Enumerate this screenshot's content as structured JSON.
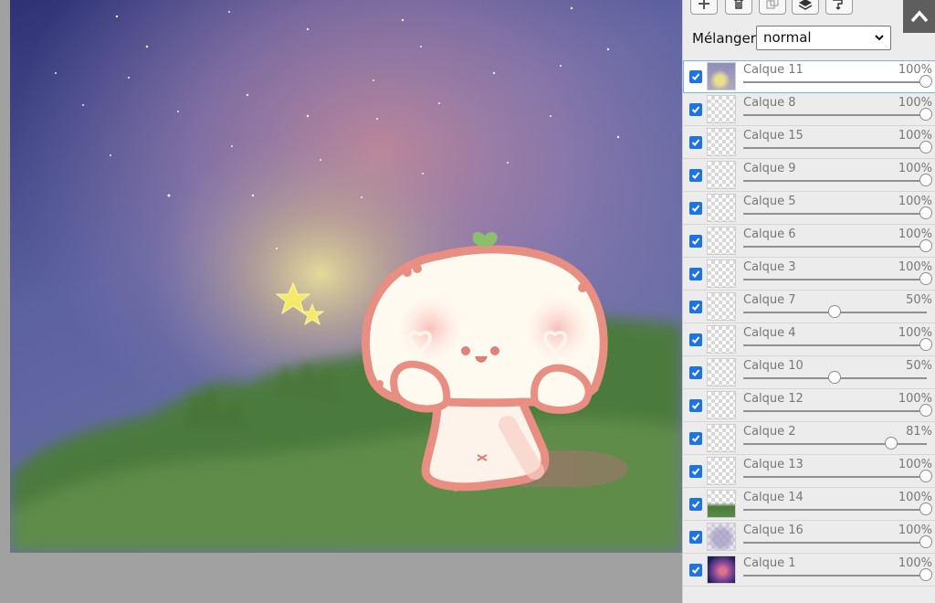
{
  "toolbar": {
    "icons": [
      "plus-icon",
      "trash-icon",
      "duplicate-icon",
      "layers-icon",
      "merge-down-icon"
    ],
    "collapse_icon": "chevron-up-icon"
  },
  "blend": {
    "label": "Mélanger",
    "value": "normal"
  },
  "layers": [
    {
      "name": "Calque 11",
      "opacity": "100%",
      "level": 100,
      "visible": true,
      "selected": true,
      "thumb": "glow"
    },
    {
      "name": "Calque 8",
      "opacity": "100%",
      "level": 100,
      "visible": true,
      "thumb": "empty"
    },
    {
      "name": "Calque 15",
      "opacity": "100%",
      "level": 100,
      "visible": true,
      "thumb": "empty"
    },
    {
      "name": "Calque 9",
      "opacity": "100%",
      "level": 100,
      "visible": true,
      "thumb": "empty"
    },
    {
      "name": "Calque 5",
      "opacity": "100%",
      "level": 100,
      "visible": true,
      "thumb": "empty"
    },
    {
      "name": "Calque 6",
      "opacity": "100%",
      "level": 100,
      "visible": true,
      "thumb": "empty"
    },
    {
      "name": "Calque 3",
      "opacity": "100%",
      "level": 100,
      "visible": true,
      "thumb": "empty"
    },
    {
      "name": "Calque 7",
      "opacity": "50%",
      "level": 50,
      "visible": true,
      "thumb": "empty"
    },
    {
      "name": "Calque 4",
      "opacity": "100%",
      "level": 100,
      "visible": true,
      "thumb": "empty"
    },
    {
      "name": "Calque 10",
      "opacity": "50%",
      "level": 50,
      "visible": true,
      "thumb": "empty"
    },
    {
      "name": "Calque 12",
      "opacity": "100%",
      "level": 100,
      "visible": true,
      "thumb": "empty"
    },
    {
      "name": "Calque 2",
      "opacity": "81%",
      "level": 81,
      "visible": true,
      "thumb": "empty"
    },
    {
      "name": "Calque 13",
      "opacity": "100%",
      "level": 100,
      "visible": true,
      "thumb": "empty"
    },
    {
      "name": "Calque 14",
      "opacity": "100%",
      "level": 100,
      "visible": true,
      "thumb": "grass"
    },
    {
      "name": "Calque 16",
      "opacity": "100%",
      "level": 100,
      "visible": true,
      "thumb": "haze"
    },
    {
      "name": "Calque 1",
      "opacity": "100%",
      "level": 100,
      "visible": true,
      "thumb": "sky"
    }
  ],
  "colors": {
    "checkbox": "#1a73e8",
    "selected_outline": "#7fb2e8",
    "panel_bg": "#ececec"
  }
}
